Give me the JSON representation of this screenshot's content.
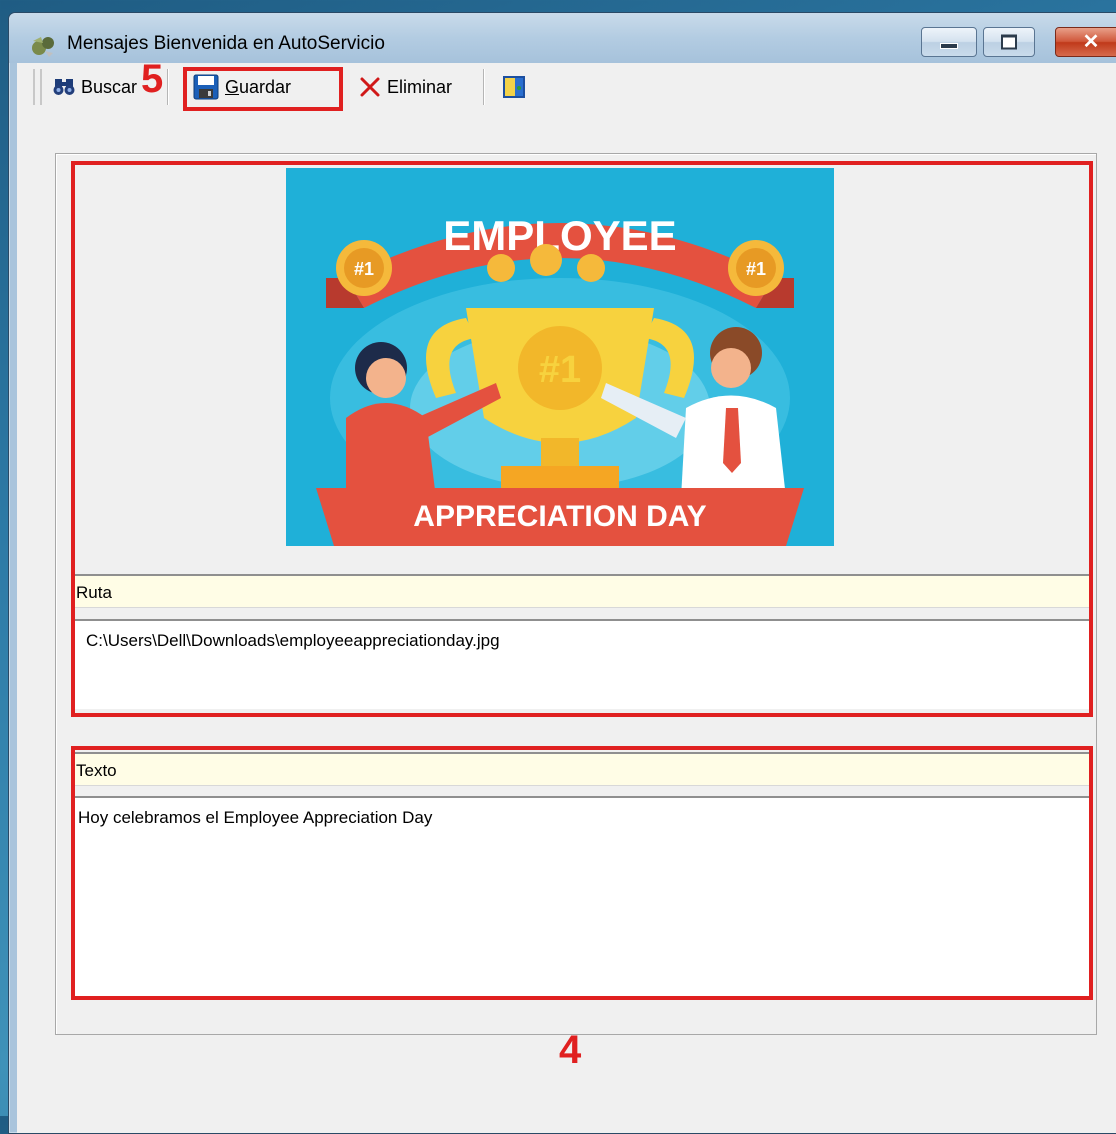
{
  "window": {
    "title": "Mensajes Bienvenida en AutoServicio",
    "controls": {
      "minimize": "—",
      "maximize": "▢",
      "close": "✕"
    }
  },
  "toolbar": {
    "search_label": "Buscar",
    "save_label_underlined": "G",
    "save_label_rest": "uardar",
    "delete_label": "Eliminar"
  },
  "image_panel": {
    "banner_text": "EMPLOYEE",
    "footer_text": "APPRECIATION DAY",
    "medal_text": "#1",
    "trophy_text": "#1"
  },
  "ruta": {
    "label": "Ruta",
    "value": "C:\\Users\\Dell\\Downloads\\employeeappreciationday.jpg"
  },
  "texto": {
    "label": "Texto",
    "value": "Hoy celebramos el Employee Appreciation Day"
  },
  "annotations": {
    "step_save": "5",
    "step_fields": "4"
  },
  "colors": {
    "annotation_red": "#e02020",
    "label_bg": "#fffde6",
    "image_bg": "#1fb0d8"
  }
}
